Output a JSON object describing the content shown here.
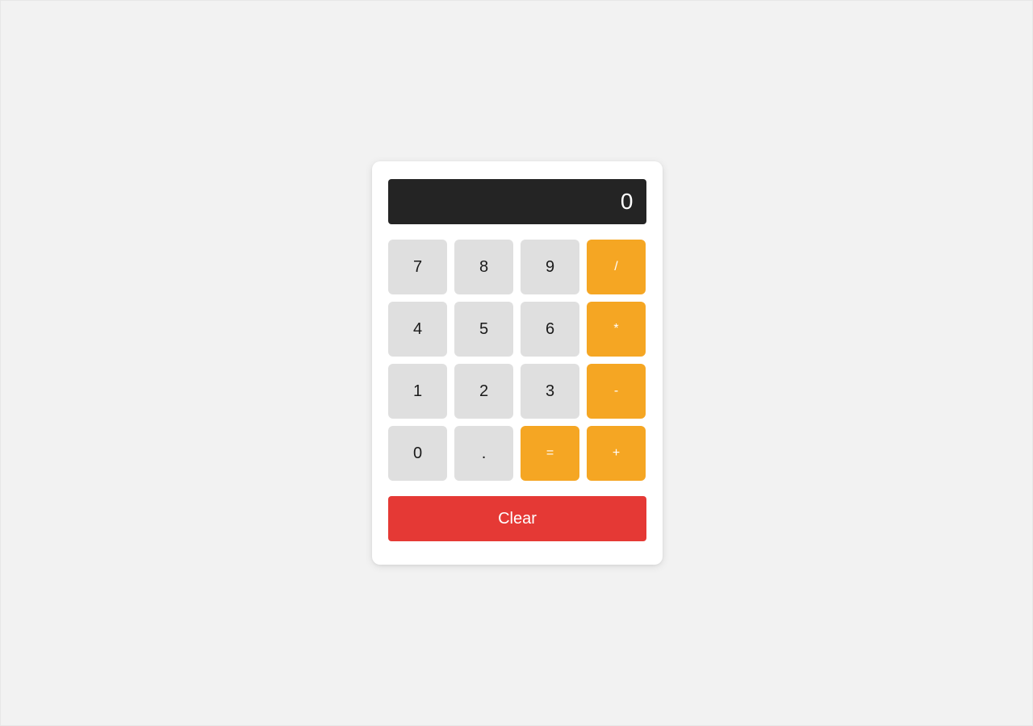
{
  "page": {
    "background_color": "#f2f2f2"
  },
  "calculator": {
    "display": {
      "value": "0",
      "background_color": "#242424",
      "text_color": "#ffffff"
    },
    "colors": {
      "digit_key": "#dfdfdf",
      "operator_key": "#f5a623",
      "clear_key": "#e53935",
      "card": "#ffffff"
    },
    "keys": [
      {
        "label": "7",
        "type": "digit",
        "name": "key-7"
      },
      {
        "label": "8",
        "type": "digit",
        "name": "key-8"
      },
      {
        "label": "9",
        "type": "digit",
        "name": "key-9"
      },
      {
        "label": "/",
        "type": "operator",
        "name": "key-divide"
      },
      {
        "label": "4",
        "type": "digit",
        "name": "key-4"
      },
      {
        "label": "5",
        "type": "digit",
        "name": "key-5"
      },
      {
        "label": "6",
        "type": "digit",
        "name": "key-6"
      },
      {
        "label": "*",
        "type": "operator",
        "name": "key-multiply"
      },
      {
        "label": "1",
        "type": "digit",
        "name": "key-1"
      },
      {
        "label": "2",
        "type": "digit",
        "name": "key-2"
      },
      {
        "label": "3",
        "type": "digit",
        "name": "key-3"
      },
      {
        "label": "-",
        "type": "operator",
        "name": "key-subtract"
      },
      {
        "label": "0",
        "type": "digit",
        "name": "key-0"
      },
      {
        "label": ".",
        "type": "digit",
        "name": "key-decimal"
      },
      {
        "label": "=",
        "type": "operator",
        "name": "key-equals"
      },
      {
        "label": "+",
        "type": "operator",
        "name": "key-add"
      }
    ],
    "clear": {
      "label": "Clear"
    }
  }
}
